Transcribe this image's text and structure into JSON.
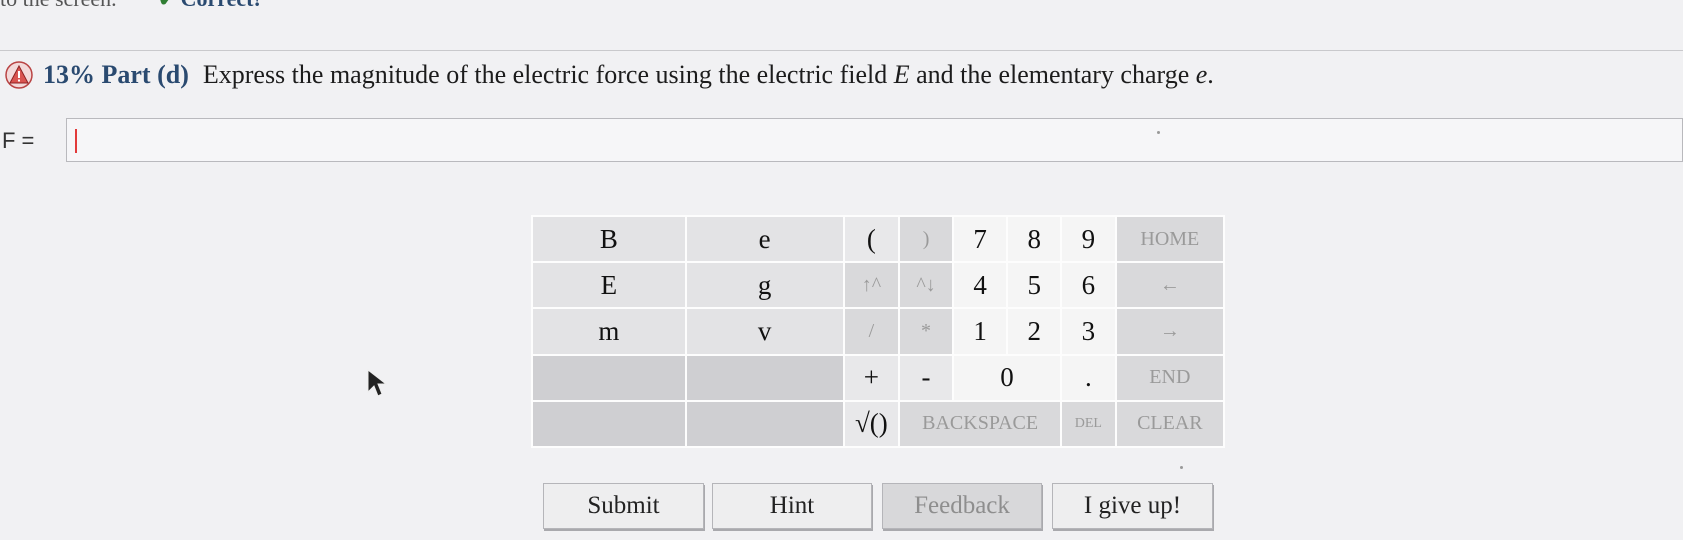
{
  "top_strip": {
    "left_text": "to the screen.",
    "right_text": "Correct!"
  },
  "question": {
    "percent": "13%",
    "part": "Part (d)",
    "text_before_E": "Express the magnitude of the electric force using the electric field",
    "var_E": "E",
    "text_middle": "and the elementary charge",
    "var_e": "e",
    "text_end": "."
  },
  "answer": {
    "label": "F =",
    "value": ""
  },
  "keypad": {
    "rows": [
      [
        "B",
        "e",
        "(",
        ")",
        "7",
        "8",
        "9",
        "HOME"
      ],
      [
        "E",
        "g",
        "↑^",
        "^↓",
        "4",
        "5",
        "6",
        "←"
      ],
      [
        "m",
        "v",
        "/",
        "*",
        "1",
        "2",
        "3",
        "→"
      ],
      [
        "",
        "",
        "+",
        "-",
        "0",
        ".",
        "END"
      ],
      [
        "",
        "",
        "√()",
        "BACKSPACE",
        "DEL",
        "CLEAR"
      ]
    ]
  },
  "buttons": {
    "submit": "Submit",
    "hint": "Hint",
    "feedback": "Feedback",
    "give_up": "I give up!"
  },
  "colors": {
    "accent": "#2a4a70",
    "warning": "#d9534f"
  }
}
